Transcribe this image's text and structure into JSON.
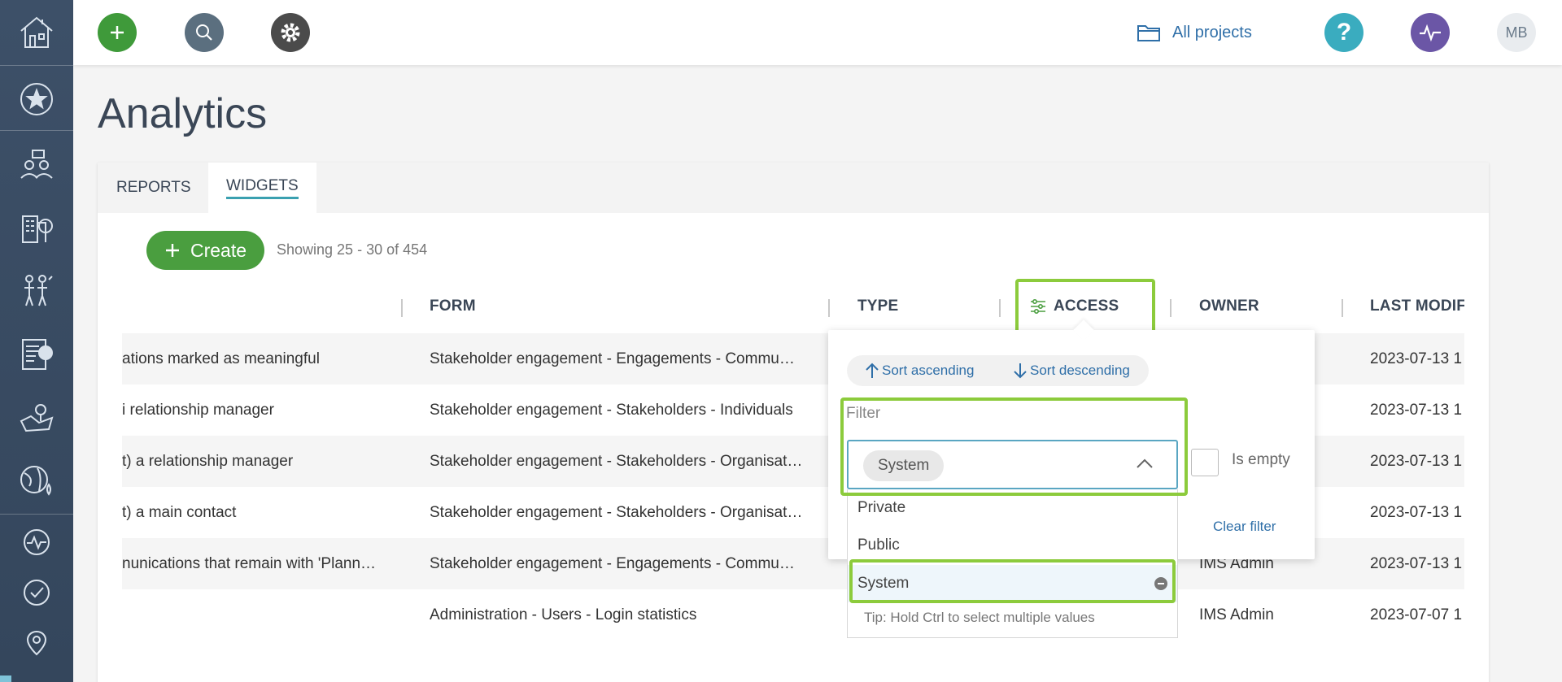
{
  "sidebar": {
    "items": [
      {
        "icon": "home-icon"
      },
      {
        "icon": "star-icon"
      },
      {
        "icon": "stakeholders-icon"
      },
      {
        "icon": "buildings-icon"
      },
      {
        "icon": "people-icon"
      },
      {
        "icon": "checklist-icon"
      },
      {
        "icon": "map-icon"
      },
      {
        "icon": "globe-icon"
      },
      {
        "icon": "activity-icon"
      },
      {
        "icon": "check-circle-icon"
      },
      {
        "icon": "location-pin-icon"
      }
    ]
  },
  "topbar": {
    "all_projects": "All projects",
    "avatar_initials": "MB",
    "colors": {
      "add": "#3f9a3a",
      "search": "#5b6f7f",
      "settings": "#4b4b4b",
      "help": "#3aacbf",
      "activity": "#6b56a6",
      "avatar": "#e9ecef"
    }
  },
  "page": {
    "title": "Analytics",
    "tabs": [
      {
        "label": "REPORTS"
      },
      {
        "label": "WIDGETS"
      }
    ],
    "create_label": "Create",
    "showing": "Showing 25 - 30 of 454"
  },
  "table": {
    "headers": {
      "form": "FORM",
      "type": "TYPE",
      "access": "ACCESS",
      "owner": "OWNER",
      "last_modified": "LAST MODIF"
    },
    "rows": [
      {
        "name": "ations marked as meaningful",
        "form": "Stakeholder engagement - Engagements - Commu…",
        "owner": "",
        "last_modified": "2023-07-13 1"
      },
      {
        "name": "i relationship manager",
        "form": "Stakeholder engagement - Stakeholders - Individuals",
        "owner": "",
        "last_modified": "2023-07-13 1"
      },
      {
        "name": "t) a relationship manager",
        "form": "Stakeholder engagement - Stakeholders - Organisat…",
        "owner": "",
        "last_modified": "2023-07-13 1"
      },
      {
        "name": "t) a main contact",
        "form": "Stakeholder engagement - Stakeholders - Organisat…",
        "owner": "",
        "last_modified": "2023-07-13 1"
      },
      {
        "name": "nunications that remain with 'Plann…",
        "form": "Stakeholder engagement - Engagements - Commu…",
        "owner": "IMS Admin",
        "last_modified": "2023-07-13 1"
      },
      {
        "name": "",
        "form": "Administration - Users - Login statistics",
        "owner": "IMS Admin",
        "last_modified": "2023-07-07 1"
      }
    ]
  },
  "filter_popover": {
    "sort_ascending": "Sort ascending",
    "sort_descending": "Sort descending",
    "filter_label": "Filter",
    "selected_chip": "System",
    "is_empty": "Is empty",
    "clear_filter": "Clear filter",
    "options": [
      {
        "label": "Private"
      },
      {
        "label": "Public"
      },
      {
        "label": "System"
      }
    ],
    "tip": "Tip: Hold Ctrl to select multiple values"
  },
  "highlight_color": "#8ccb3c"
}
